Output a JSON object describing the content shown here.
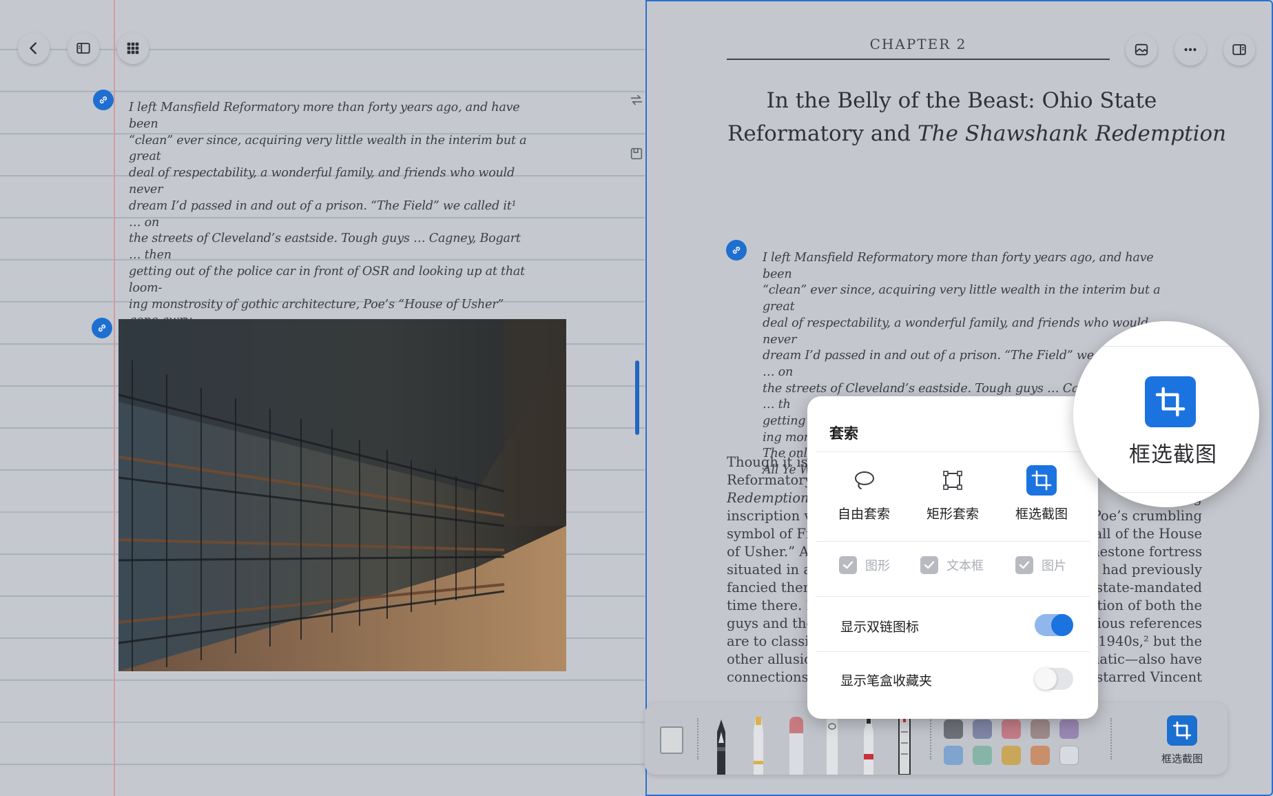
{
  "left_pane": {
    "quote": "I left Mansfield Reformatory more than forty years ago, and have been\n“clean” ever since, acquiring very little wealth in the interim but a great\ndeal of respectability, a wonderful family, and friends who would never\ndream I’d passed in and out of a prison. “The Field” we called it¹ … on\nthe streets of Cleveland’s eastside. Tough guys … Cagney, Bogart … then\ngetting out of the police car in front of OSR and looking up at that loom-\ning monstrosity of gothic architecture, Poe’s “House of Usher” gone awry.\nThe only thing missing was that proverbial inscription, “Abandon Hope\nAll Ye Who Enter Here!” (Inmates)"
  },
  "right_pane": {
    "chapter": "CHAPTER 2",
    "title_line1": "In the Belly of the Beast: Ohio State",
    "title_line2_plain": "Reformatory and ",
    "title_line2_italic": "The Shawshank Redemption",
    "quote": "I left Mansfield Reformatory more than forty years ago, and have been\n“clean” ever since, acquiring very little wealth in the interim but a great\ndeal of respectability, a wonderful family, and friends who would never\ndream I’d passed in and out of a prison. “The Field” we called it¹ … on\nthe streets of Cleveland’s eastside. Tough guys … Cagney, Bogart … th\ngetting out of the police car in front of OSR and looking up at th\ning monstrosity of gothic architecture, Poe’s “House of Usher\nThe only thing missing was that proverbial inscription, “A\nAll Ye Who Enter Here!” (Inmates)",
    "body_left": [
      "Though it isn",
      "Reformatory (",
      "Redemption ar",
      "inscription visi",
      "symbol of Freu",
      "of Usher.” As t",
      "situated in a lo",
      "fancied thems",
      "time there. Li",
      "guys and the p",
      "are to classic g",
      "other allusions",
      "connections to"
    ],
    "body_right": [
      "",
      "",
      "acing",
      "Poe’s crumbling",
      "Fall of the House",
      "mestone fortress",
      "o had previously",
      "e state-mandated",
      "tion of both the",
      "vious references",
      "1940s,² but the",
      "matic—also have",
      "starred Vincent"
    ]
  },
  "popup": {
    "title": "套索",
    "modes": [
      {
        "label": "自由套索",
        "icon": "lasso-icon"
      },
      {
        "label": "矩形套索",
        "icon": "rect-lasso-icon"
      },
      {
        "label": "框选截图",
        "icon": "crop-icon"
      }
    ],
    "filters": [
      {
        "label": "图形",
        "checked": true
      },
      {
        "label": "文本框",
        "checked": true
      },
      {
        "label": "图片",
        "checked": true
      }
    ],
    "toggles": [
      {
        "label": "显示双链图标",
        "on": true
      },
      {
        "label": "显示笔盒收藏夹",
        "on": false
      }
    ]
  },
  "magnifier": {
    "label": "框选截图"
  },
  "toolbar": {
    "active_tool_label": "框选截图",
    "colors_row1": [
      "#6e7177",
      "#7f86a6",
      "#c47c86",
      "#9e8a8a",
      "#9a88b4"
    ],
    "colors_row2": [
      "#7ea4cf",
      "#86b5a8",
      "#c9a65a",
      "#c98f6a",
      "#d7dadf"
    ]
  }
}
